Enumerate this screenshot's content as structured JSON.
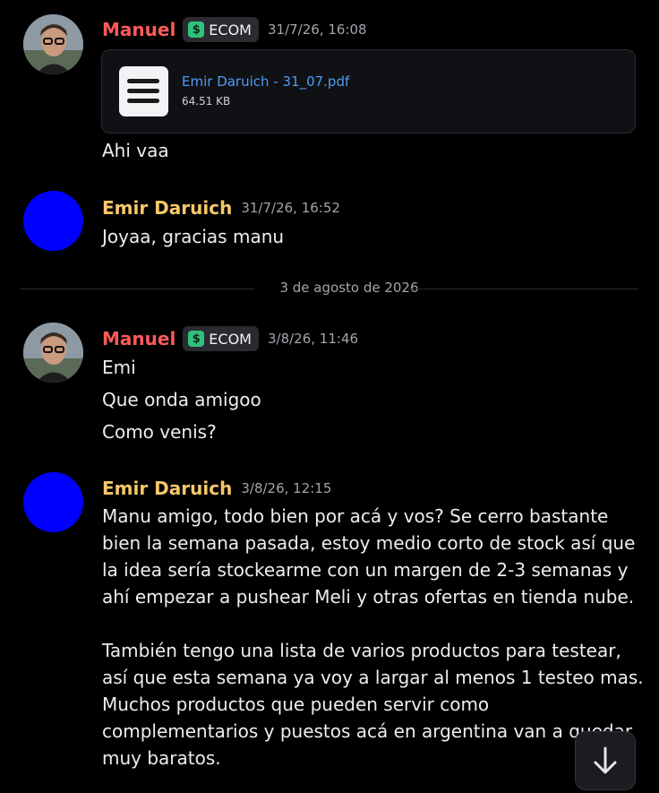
{
  "colors": {
    "background": "#000000",
    "manuel_name": "#ff5a5a",
    "emir_name": "#f6c76a",
    "link": "#4f9cf4",
    "badge_icon": "#2fc27a"
  },
  "messages": [
    {
      "author": "Manuel",
      "badge": "ECOM",
      "badge_icon": "dollar-leaf-icon",
      "time": "31/7/26, 16:08",
      "attachment": {
        "name": "Emir Daruich - 31_07.pdf",
        "size": "64.51 KB",
        "icon": "document-icon"
      },
      "lines": [
        "Ahi vaa"
      ]
    },
    {
      "author": "Emir Daruich",
      "time": "31/7/26, 16:52",
      "lines": [
        "Joyaa, gracias manu"
      ]
    },
    {
      "author": "Manuel",
      "badge": "ECOM",
      "badge_icon": "dollar-leaf-icon",
      "time": "3/8/26, 11:46",
      "lines": [
        "Emi",
        "Que onda amigoo",
        "Como venis?"
      ]
    },
    {
      "author": "Emir Daruich",
      "time": "3/8/26, 12:15",
      "lines": [
        "Manu amigo, todo bien por acá y vos? Se cerro bastante",
        "bien la semana pasada, estoy medio corto de stock así que",
        "la idea sería stockearme con un margen de 2-3 semanas y",
        "ahí empezar a pushear Meli y otras ofertas en tienda nube.",
        "",
        "También tengo una lista de varios productos para testear,",
        "así que esta semana ya voy a largar al menos 1 testeo mas.",
        "Muchos productos que pueden servir como",
        "complementarios y puestos acá en argentina van a quedar",
        "muy baratos."
      ]
    }
  ],
  "date_divider": "3 de agosto de 2026",
  "scroll_button_icon": "arrow-down-icon"
}
